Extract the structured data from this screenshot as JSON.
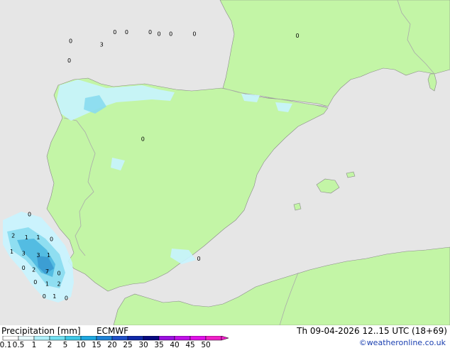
{
  "header": {
    "title": "Precipitation [mm]",
    "model": "ECMWF",
    "datetime": "Th 09-04-2026 12..15 UTC (18+69)",
    "credit": "©weatheronline.co.uk"
  },
  "legend": {
    "ticks": [
      "0.1",
      "0.5",
      "1",
      "2",
      "5",
      "10",
      "15",
      "20",
      "25",
      "30",
      "35",
      "40",
      "45",
      "50"
    ],
    "colors": [
      "#ffffff",
      "#e8faff",
      "#b0f0fa",
      "#72dff0",
      "#40c8e6",
      "#1fa8e0",
      "#1e82d6",
      "#2050c8",
      "#1028a8",
      "#080a80",
      "#9a10e0",
      "#c010e8",
      "#e010e8",
      "#f020c8"
    ]
  },
  "map": {
    "colors": {
      "sea": "#e6e6e6",
      "land": "#c3f5a6",
      "border": "#aaaaaa",
      "coast": "#888888",
      "rain_light": "#c8f4ff",
      "rain_mid": "#88dcf0",
      "rain_strong": "#4cb8e0",
      "rain_heavy": "#3a9ad2"
    },
    "precip_labels": [
      {
        "text": "0",
        "lon": -7.3,
        "lat": 43.3
      },
      {
        "text": "0",
        "lon": -6.9,
        "lat": 43.3
      },
      {
        "text": "0",
        "lon": -6.1,
        "lat": 43.3
      },
      {
        "text": "0",
        "lon": -5.8,
        "lat": 43.25
      },
      {
        "text": "0",
        "lon": -5.4,
        "lat": 43.25
      },
      {
        "text": "0",
        "lon": -4.6,
        "lat": 43.25
      },
      {
        "text": "0",
        "lon": -1.1,
        "lat": 43.2
      },
      {
        "text": "0",
        "lon": -8.8,
        "lat": 43.05
      },
      {
        "text": "3",
        "lon": -7.75,
        "lat": 42.95
      },
      {
        "text": "0",
        "lon": -8.85,
        "lat": 42.5
      },
      {
        "text": "0",
        "lon": -6.35,
        "lat": 40.3
      },
      {
        "text": "0",
        "lon": -10.2,
        "lat": 38.2
      },
      {
        "text": "2",
        "lon": -10.75,
        "lat": 37.6
      },
      {
        "text": "1",
        "lon": -10.3,
        "lat": 37.55
      },
      {
        "text": "1",
        "lon": -9.9,
        "lat": 37.55
      },
      {
        "text": "0",
        "lon": -9.45,
        "lat": 37.5
      },
      {
        "text": "1",
        "lon": -10.8,
        "lat": 37.15
      },
      {
        "text": "3",
        "lon": -10.4,
        "lat": 37.1
      },
      {
        "text": "3",
        "lon": -9.9,
        "lat": 37.05
      },
      {
        "text": "1",
        "lon": -9.55,
        "lat": 37.05
      },
      {
        "text": "0",
        "lon": -10.4,
        "lat": 36.7
      },
      {
        "text": "2",
        "lon": -10.05,
        "lat": 36.65
      },
      {
        "text": "7",
        "lon": -9.6,
        "lat": 36.6
      },
      {
        "text": "0",
        "lon": -9.2,
        "lat": 36.55
      },
      {
        "text": "0",
        "lon": -10.0,
        "lat": 36.3
      },
      {
        "text": "1",
        "lon": -9.6,
        "lat": 36.25
      },
      {
        "text": "2",
        "lon": -9.2,
        "lat": 36.25
      },
      {
        "text": "0",
        "lon": -9.7,
        "lat": 35.9
      },
      {
        "text": "1",
        "lon": -9.35,
        "lat": 35.9
      },
      {
        "text": "0",
        "lon": -8.95,
        "lat": 35.85
      },
      {
        "text": "0",
        "lon": -4.45,
        "lat": 36.95
      }
    ]
  }
}
